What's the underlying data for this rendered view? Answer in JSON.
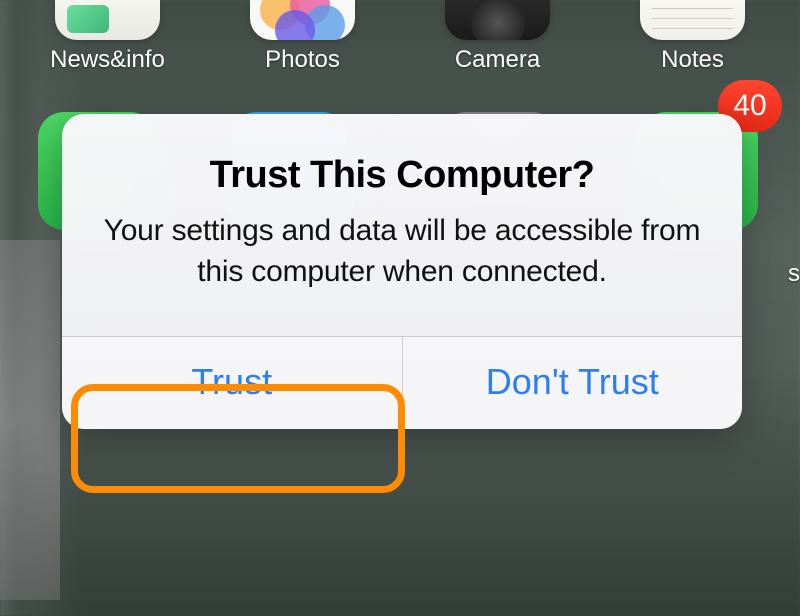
{
  "apps": [
    {
      "label": "News&info"
    },
    {
      "label": "Photos"
    },
    {
      "label": "Camera"
    },
    {
      "label": "Notes"
    }
  ],
  "badge": {
    "count": "40"
  },
  "cropped_row2_label_fragment": "s",
  "alert": {
    "title": "Trust This Computer?",
    "message": "Your settings and data will be accessible from this computer when connected.",
    "buttons": {
      "trust": "Trust",
      "dont_trust": "Don't Trust"
    }
  },
  "highlight": {
    "target": "trust-button",
    "color": "#ff8c00"
  }
}
